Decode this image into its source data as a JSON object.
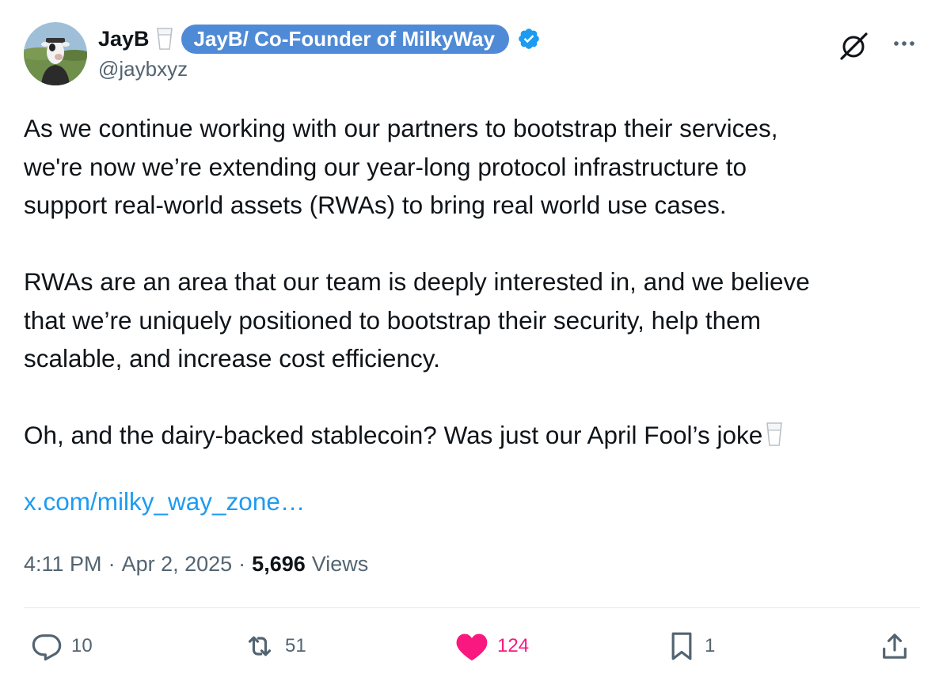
{
  "author": {
    "display_name": "JayB",
    "affiliation_label": "JayB/ Co-Founder of MilkyWay",
    "handle": "@jaybxyz",
    "avatar": "cow-avatar"
  },
  "header_icons": {
    "grok": "grok-icon",
    "more": "more-icon"
  },
  "tweet": {
    "paragraphs": [
      "As we continue working with our partners to bootstrap their services,\nwe're now we’re extending our year-long protocol infrastructure to\nsupport real-world assets (RWAs) to bring real world use cases.",
      "RWAs are an area that our team is deeply interested in, and we believe\nthat we’re uniquely positioned to bootstrap their security, help them\nscalable, and increase cost efficiency.",
      "Oh, and the dairy-backed stablecoin? Was just our April Fool’s joke"
    ],
    "link": "x.com/milky_way_zone…"
  },
  "meta": {
    "time": "4:11 PM",
    "sep1": "·",
    "date": "Apr 2, 2025",
    "sep2": "·",
    "views_count": "5,696",
    "views_label": "Views"
  },
  "actions": {
    "replies": "10",
    "reposts": "51",
    "likes": "124",
    "bookmarks": "1"
  },
  "colors": {
    "accent_badge": "#4f8ad6",
    "verified": "#1d9bf0",
    "link": "#1d9bf0",
    "like": "#f91880",
    "muted": "#536471"
  }
}
